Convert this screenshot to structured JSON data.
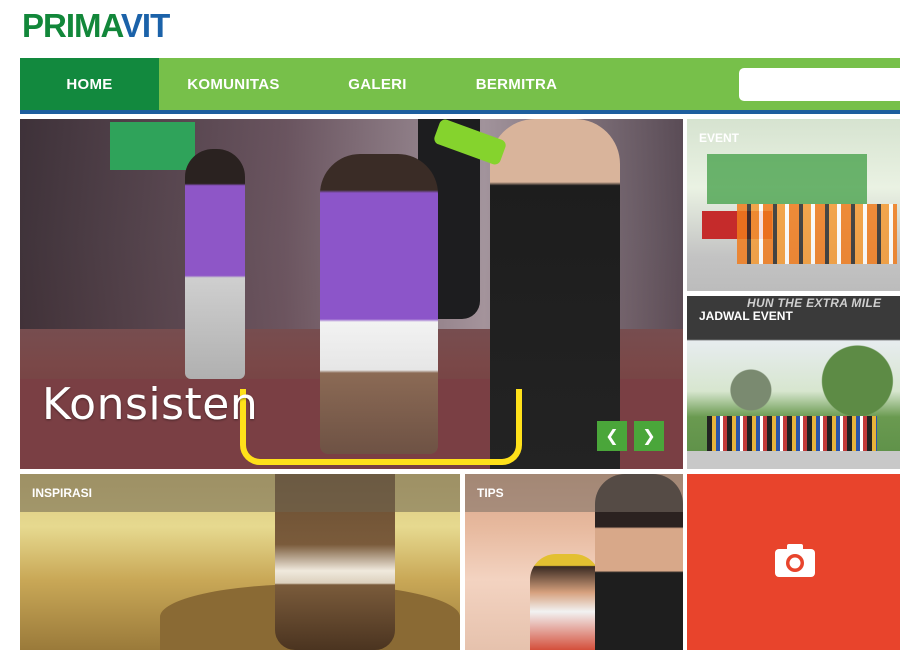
{
  "logo": {
    "part1": "PRIMA",
    "part2": "VIT"
  },
  "nav": {
    "items": [
      {
        "label": "HOME",
        "active": true
      },
      {
        "label": "KOMUNITAS",
        "active": false
      },
      {
        "label": "GALERI",
        "active": false
      },
      {
        "label": "BERMITRA",
        "active": false
      }
    ],
    "search_placeholder": ""
  },
  "hero": {
    "caption": "Konsisten",
    "prev_icon": "chevron-left-icon",
    "next_icon": "chevron-right-icon",
    "prev_glyph": "❮",
    "next_glyph": "❯"
  },
  "tiles": {
    "event": {
      "label": "EVENT"
    },
    "jadwal": {
      "label": "JADWAL EVENT",
      "arch_text": "HUN THE EXTRA MILE"
    },
    "inspirasi": {
      "label": "INSPIRASI"
    },
    "tips": {
      "label": "TIPS"
    },
    "galeri": {
      "icon": "camera-icon"
    }
  },
  "colors": {
    "nav_green": "#77c04a",
    "nav_active": "#12893e",
    "nav_underline": "#1d5e9e",
    "gallery_red": "#e8442c",
    "logo_green": "#12873a",
    "logo_blue": "#1b62a9"
  }
}
